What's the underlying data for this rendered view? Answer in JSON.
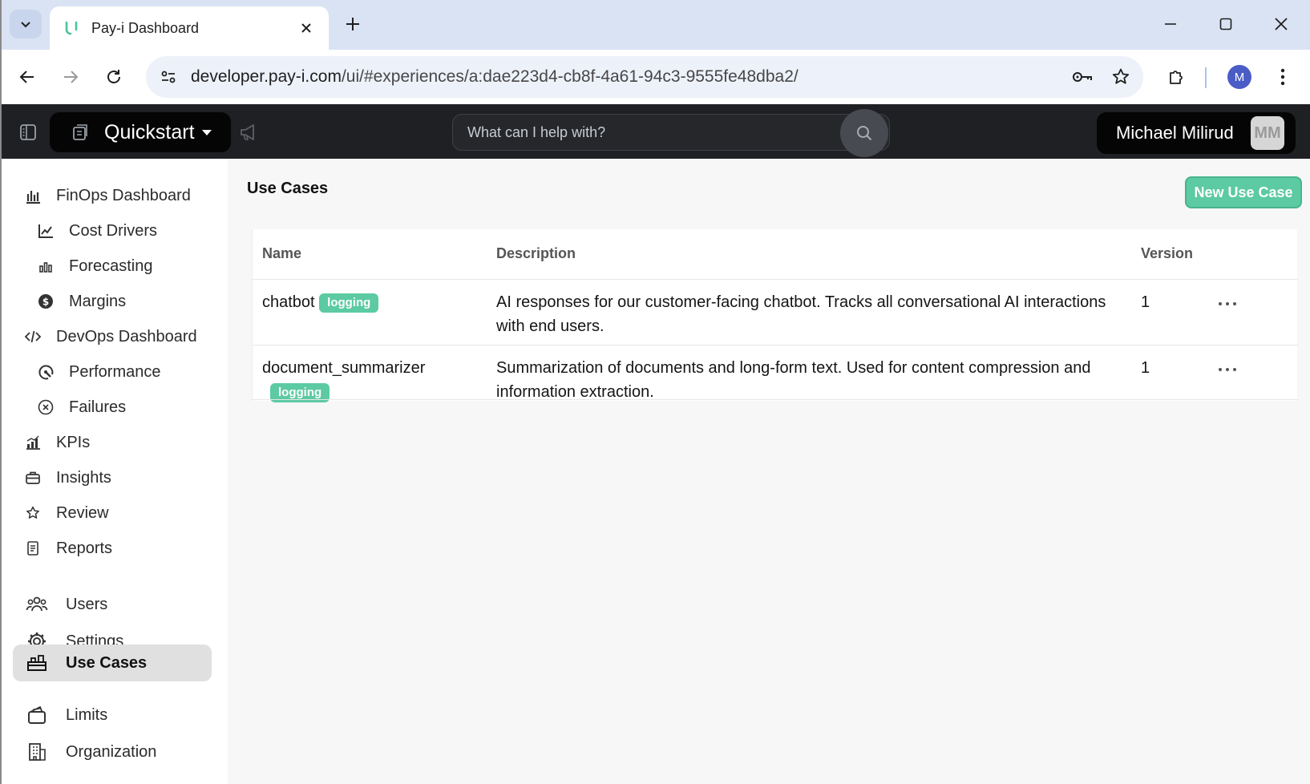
{
  "browser": {
    "tab_title": "Pay-i Dashboard",
    "url_host": "developer.pay-i.com",
    "url_path": "/ui/#experiences/a:dae223d4-cb8f-4a61-94c3-9555fe48dba2/",
    "profile_initial": "M"
  },
  "header": {
    "workspace": "Quickstart",
    "search_placeholder": "What can I help with?",
    "user_name": "Michael Milirud",
    "user_initials": "MM"
  },
  "sidebar": {
    "items": [
      {
        "label": "FinOps Dashboard",
        "icon": "bar-chart-icon"
      },
      {
        "label": "Cost Drivers",
        "icon": "line-chart-icon"
      },
      {
        "label": "Forecasting",
        "icon": "forecast-icon"
      },
      {
        "label": "Margins",
        "icon": "dollar-coin-icon"
      },
      {
        "label": "DevOps Dashboard",
        "icon": "code-icon"
      },
      {
        "label": "Performance",
        "icon": "speedometer-icon"
      },
      {
        "label": "Failures",
        "icon": "x-circle-icon"
      },
      {
        "label": "KPIs",
        "icon": "kpi-chart-icon"
      },
      {
        "label": "Insights",
        "icon": "briefcase-icon"
      },
      {
        "label": "Review",
        "icon": "star-icon"
      },
      {
        "label": "Reports",
        "icon": "document-icon"
      },
      {
        "label": "Users",
        "icon": "users-icon"
      },
      {
        "label": "Settings",
        "icon": "gear-icon"
      },
      {
        "label": "Use Cases",
        "icon": "use-cases-icon"
      },
      {
        "label": "Limits",
        "icon": "wallet-icon"
      },
      {
        "label": "Organization",
        "icon": "building-icon"
      }
    ],
    "active": "Use Cases"
  },
  "main": {
    "title": "Use Cases",
    "new_button": "New Use Case",
    "columns": [
      "Name",
      "Description",
      "Version"
    ],
    "rows": [
      {
        "name": "chatbot",
        "badge": "logging",
        "description_line1": "AI responses for our customer-facing chatbot. Tracks all conversational AI interactions",
        "description_line2": "with end users.",
        "version": "1"
      },
      {
        "name": "document_summarizer",
        "badge": "logging",
        "description_line1": "Summarization of documents and long-form text. Used for content compression and",
        "description_line2": "information extraction.",
        "version": "1"
      }
    ]
  },
  "colors": {
    "accent": "#5ccaa2",
    "appbar": "#1f2023",
    "active_item": "#e0e0e0"
  }
}
